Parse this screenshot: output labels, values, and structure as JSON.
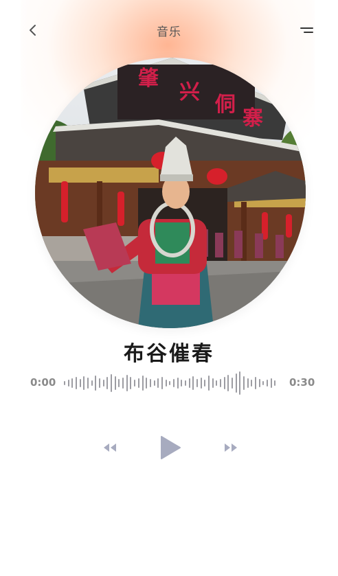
{
  "header": {
    "title": "音乐",
    "back_icon": "chevron-left-icon",
    "menu_icon": "menu-lines-icon"
  },
  "artwork": {
    "icon": "album-cover-image",
    "sign_text": "肇兴侗寨"
  },
  "track": {
    "title": "布谷催春"
  },
  "progress": {
    "current_time": "0:00",
    "total_time": "0:30",
    "fraction_played": 0
  },
  "controls": {
    "rewind_icon": "rewind-icon",
    "play_icon": "play-icon",
    "forward_icon": "fast-forward-icon"
  },
  "colors": {
    "accent_glow": "#ffb08c",
    "control_gray": "#a7abbf",
    "waveform_gray": "#9c9ca2",
    "text_dark": "#1a1a1a",
    "text_muted": "#8a8a8a"
  }
}
